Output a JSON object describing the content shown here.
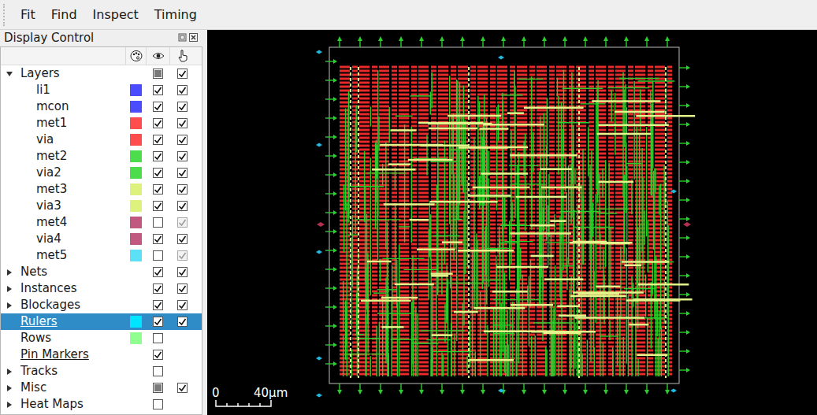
{
  "menu": [
    {
      "label": "Fit"
    },
    {
      "label": "Find"
    },
    {
      "label": "Inspect"
    },
    {
      "label": "Timing"
    }
  ],
  "panel": {
    "title": "Display Control"
  },
  "tree": [
    {
      "label": "Layers",
      "expandable": true,
      "expanded": true,
      "selected": false,
      "underlined": false,
      "visible": false,
      "partial": true,
      "has_select": true,
      "selectable": true,
      "select_disabled": false,
      "children": [
        {
          "label": "li1",
          "color": "#4c4cff",
          "expandable": false,
          "expanded": false,
          "selected": false,
          "underlined": false,
          "visible": true,
          "partial": false,
          "has_select": true,
          "selectable": true,
          "select_disabled": false
        },
        {
          "label": "mcon",
          "color": "#4c4cff",
          "expandable": false,
          "expanded": false,
          "selected": false,
          "underlined": false,
          "visible": true,
          "partial": false,
          "has_select": true,
          "selectable": true,
          "select_disabled": false
        },
        {
          "label": "met1",
          "color": "#ff4c4c",
          "expandable": false,
          "expanded": false,
          "selected": false,
          "underlined": false,
          "visible": true,
          "partial": false,
          "has_select": true,
          "selectable": true,
          "select_disabled": false
        },
        {
          "label": "via",
          "color": "#ff4c4c",
          "expandable": false,
          "expanded": false,
          "selected": false,
          "underlined": false,
          "visible": true,
          "partial": false,
          "has_select": true,
          "selectable": true,
          "select_disabled": false
        },
        {
          "label": "met2",
          "color": "#4cdc4c",
          "expandable": false,
          "expanded": false,
          "selected": false,
          "underlined": false,
          "visible": true,
          "partial": false,
          "has_select": true,
          "selectable": true,
          "select_disabled": false
        },
        {
          "label": "via2",
          "color": "#4cdc4c",
          "expandable": false,
          "expanded": false,
          "selected": false,
          "underlined": false,
          "visible": true,
          "partial": false,
          "has_select": true,
          "selectable": true,
          "select_disabled": false
        },
        {
          "label": "met3",
          "color": "#dcf27c",
          "expandable": false,
          "expanded": false,
          "selected": false,
          "underlined": false,
          "visible": true,
          "partial": false,
          "has_select": true,
          "selectable": true,
          "select_disabled": false
        },
        {
          "label": "via3",
          "color": "#dcf27c",
          "expandable": false,
          "expanded": false,
          "selected": false,
          "underlined": false,
          "visible": true,
          "partial": false,
          "has_select": true,
          "selectable": true,
          "select_disabled": false
        },
        {
          "label": "met4",
          "color": "#c05880",
          "expandable": false,
          "expanded": false,
          "selected": false,
          "underlined": false,
          "visible": false,
          "partial": false,
          "has_select": true,
          "selectable": true,
          "select_disabled": true
        },
        {
          "label": "via4",
          "color": "#c05880",
          "expandable": false,
          "expanded": false,
          "selected": false,
          "underlined": false,
          "visible": true,
          "partial": false,
          "has_select": true,
          "selectable": true,
          "select_disabled": false
        },
        {
          "label": "met5",
          "color": "#5ce0f8",
          "expandable": false,
          "expanded": false,
          "selected": false,
          "underlined": false,
          "visible": false,
          "partial": false,
          "has_select": true,
          "selectable": true,
          "select_disabled": true
        }
      ]
    },
    {
      "label": "Nets",
      "expandable": true,
      "expanded": false,
      "selected": false,
      "underlined": false,
      "visible": true,
      "partial": false,
      "has_select": true,
      "selectable": true,
      "select_disabled": false
    },
    {
      "label": "Instances",
      "expandable": true,
      "expanded": false,
      "selected": false,
      "underlined": false,
      "visible": true,
      "partial": false,
      "has_select": true,
      "selectable": true,
      "select_disabled": false
    },
    {
      "label": "Blockages",
      "expandable": true,
      "expanded": false,
      "selected": false,
      "underlined": false,
      "visible": true,
      "partial": false,
      "has_select": true,
      "selectable": true,
      "select_disabled": false
    },
    {
      "label": "Rulers",
      "color": "#00e5ff",
      "expandable": false,
      "expanded": false,
      "selected": true,
      "underlined": true,
      "visible": true,
      "partial": false,
      "has_select": true,
      "selectable": true,
      "select_disabled": false
    },
    {
      "label": "Rows",
      "color": "#90ff90",
      "expandable": false,
      "expanded": false,
      "selected": false,
      "underlined": false,
      "visible": false,
      "partial": false,
      "has_select": false,
      "selectable": false,
      "select_disabled": false
    },
    {
      "label": "Pin Markers",
      "expandable": false,
      "expanded": false,
      "selected": false,
      "underlined": true,
      "visible": true,
      "partial": false,
      "has_select": false,
      "selectable": false,
      "select_disabled": false
    },
    {
      "label": "Tracks",
      "expandable": true,
      "expanded": false,
      "selected": false,
      "underlined": false,
      "visible": false,
      "partial": false,
      "has_select": false,
      "selectable": false,
      "select_disabled": false
    },
    {
      "label": "Misc",
      "expandable": true,
      "expanded": false,
      "selected": false,
      "underlined": false,
      "visible": false,
      "partial": true,
      "has_select": true,
      "selectable": true,
      "select_disabled": false
    },
    {
      "label": "Heat Maps",
      "expandable": true,
      "expanded": false,
      "selected": false,
      "underlined": false,
      "visible": false,
      "partial": false,
      "has_select": false,
      "selectable": false,
      "select_disabled": false
    }
  ],
  "scale": {
    "start": "0",
    "end": "40μm"
  }
}
